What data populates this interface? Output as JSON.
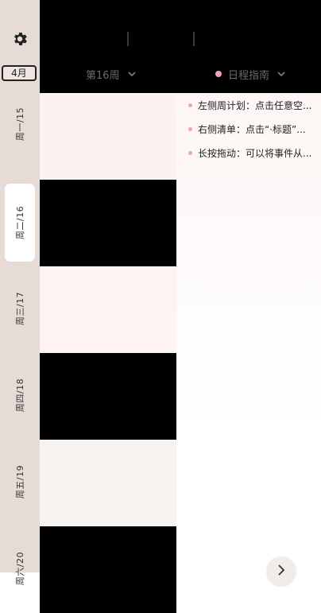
{
  "sidebar": {
    "settings_icon": "gear-icon",
    "month": "4月",
    "days": [
      {
        "label": "周一/15",
        "bg": "#e7dbd6"
      },
      {
        "label": "周二/16",
        "bg": "#ffffff",
        "active": true
      },
      {
        "label": "周三/17",
        "bg": "#e7dbd6"
      },
      {
        "label": "周四/18",
        "bg": "#e7dbd6"
      },
      {
        "label": "周五/19",
        "bg": "#e7dbd6"
      },
      {
        "label": "周六/20",
        "bg": "#e7dbd6"
      }
    ]
  },
  "header": {
    "week_label": "第16周",
    "guide_label": "日程指南",
    "week_dropdown_icon": "chevron-down-icon",
    "guide_dropdown_icon": "chevron-down-icon"
  },
  "week_columns": [
    {
      "color": "#fbf3f1"
    },
    {
      "color": "#000000"
    },
    {
      "color": "#fcf3f2"
    },
    {
      "color": "#000000"
    },
    {
      "color": "#f7f3f0"
    },
    {
      "color": "#000000"
    }
  ],
  "guide_items": [
    "左侧周计划：点击任意空...",
    "右侧清单：点击“·标题”...",
    "长按拖动：可以将事件从..."
  ],
  "colors": {
    "accent_pink": "#f3a3b5",
    "sidebar_bg": "#e7dbd6",
    "topbar_bg": "#000000"
  },
  "next_button_icon": "chevron-right-icon"
}
